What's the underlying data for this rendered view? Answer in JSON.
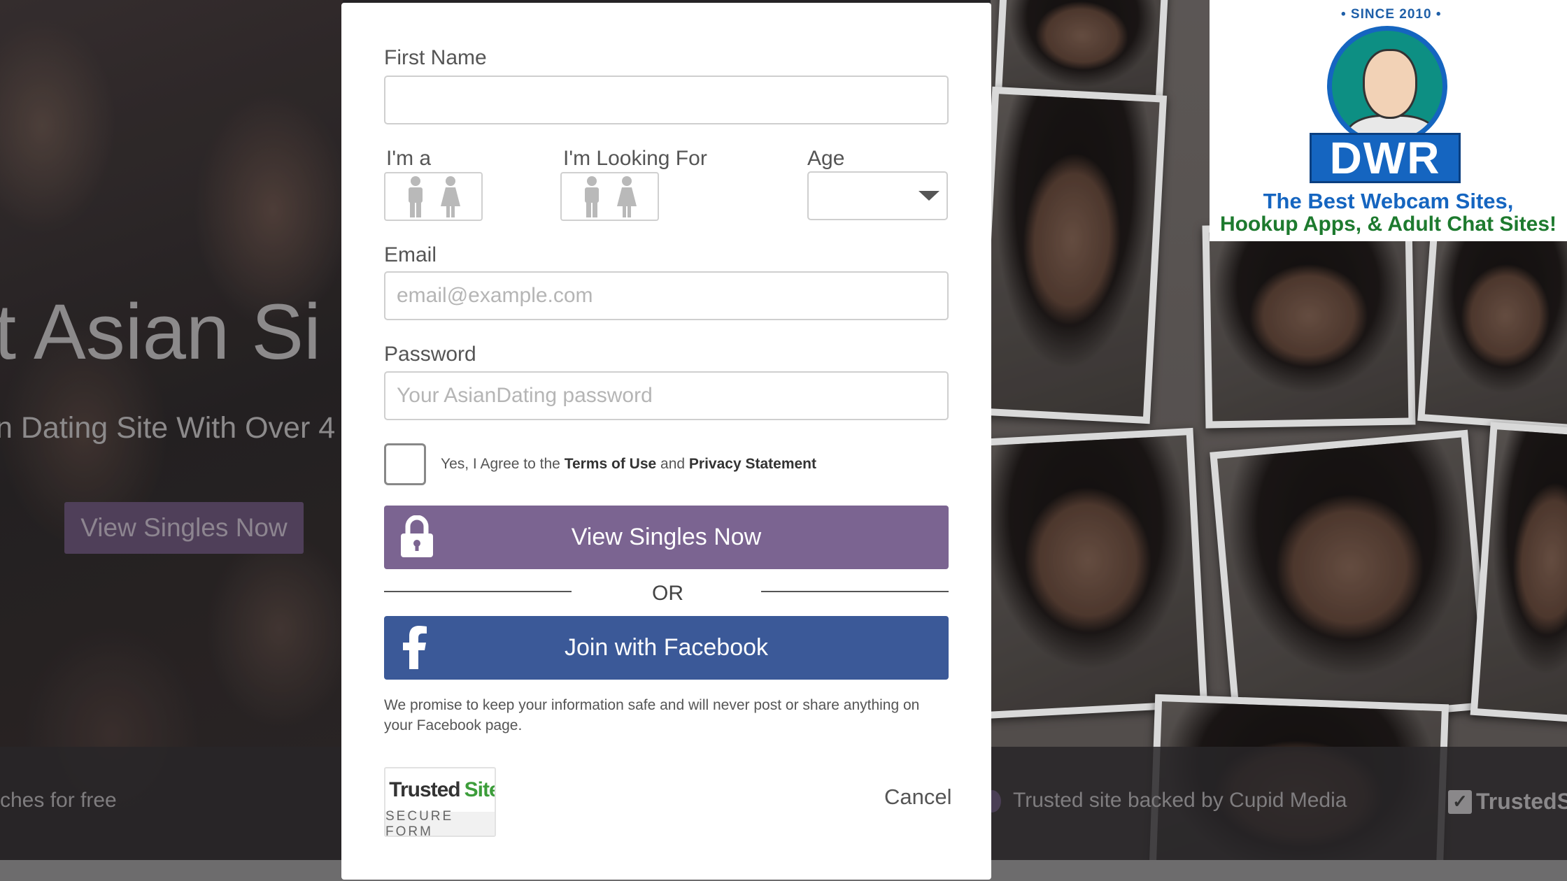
{
  "background": {
    "hero_title": "t Asian Si",
    "hero_subtitle": "n Dating Site With Over 4",
    "hero_button": "View Singles Now",
    "footer_left": "ches for free",
    "footer_right": "Trusted site backed by Cupid Media",
    "footer_trusted": "TrustedS"
  },
  "form": {
    "first_name": {
      "label": "First Name",
      "value": "",
      "placeholder": ""
    },
    "im_a": {
      "label": "I'm a",
      "options": [
        "male-icon",
        "female-icon"
      ]
    },
    "looking_for": {
      "label": "I'm Looking For",
      "options": [
        "male-icon",
        "female-icon"
      ]
    },
    "age": {
      "label": "Age",
      "value": ""
    },
    "email": {
      "label": "Email",
      "value": "",
      "placeholder": "email@example.com"
    },
    "password": {
      "label": "Password",
      "value": "",
      "placeholder": "Your AsianDating password"
    },
    "agree": {
      "prefix": "Yes, I Agree to the ",
      "terms": "Terms of Use",
      "middle": " and ",
      "privacy": "Privacy Statement",
      "checked": false
    },
    "submit_label": "View Singles Now",
    "or_text": "OR",
    "facebook_label": "Join with Facebook",
    "promise_text": "We promise to keep your information safe and will never post or share anything on your Facebook page.",
    "trusted_badge": {
      "word1": "Trusted",
      "word2": "Site",
      "reg": "®",
      "caption": "SECURE FORM"
    },
    "cancel_label": "Cancel"
  },
  "badge": {
    "since": "• SINCE 2010 •",
    "logo": "DWR",
    "line1": "The Best Webcam Sites,",
    "line2": "Hookup Apps, & Adult Chat Sites!"
  },
  "colors": {
    "primary_button": "#7b6491",
    "facebook": "#3b5998",
    "trusted_green": "#3c9d3a",
    "dwr_blue": "#1565c0",
    "dwr_green": "#1d7a2e"
  }
}
